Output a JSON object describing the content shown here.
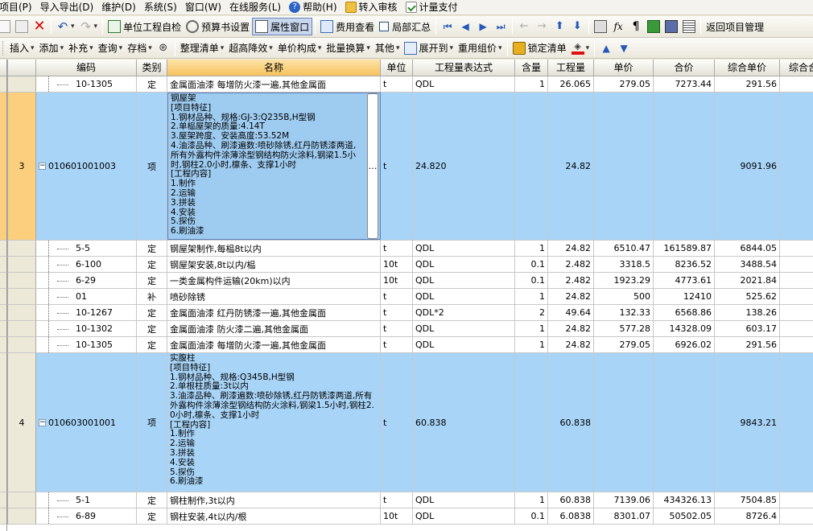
{
  "menu": [
    "项目(P)",
    "导入导出(D)",
    "维护(D)",
    "系统(S)",
    "窗口(W)",
    "在线服务(L)",
    "帮助(H)",
    "转入审核",
    "计量支付"
  ],
  "toolbar1": {
    "unit_check": "单位工程自检",
    "budget_settings": "预算书设置",
    "property_window": "属性窗口",
    "fee_view": "费用查看",
    "partial_summary": "局部汇总",
    "back_to_project": "返回项目管理"
  },
  "toolbar2": {
    "insert": "插入",
    "add": "添加",
    "supplement": "补充",
    "query": "查询",
    "save": "存档",
    "organize": "整理清单",
    "super_height": "超高降效",
    "unit_price_comp": "单价构成",
    "batch_convert": "批量换算",
    "other": "其他",
    "expand_to": "展开到",
    "reuse_price": "重用组价",
    "lock_list": "锁定清单"
  },
  "columns": [
    "编码",
    "类别",
    "名称",
    "单位",
    "工程量表达式",
    "含量",
    "工程量",
    "单价",
    "合价",
    "综合单价",
    "综合合价"
  ],
  "rows": [
    {
      "rownum": "",
      "code": "10-1305",
      "type": "定",
      "name": "金属面油漆 每增防火漆一遍,其他金属面",
      "unit": "t",
      "expr": "QDL",
      "content": "1",
      "qty": "26.065",
      "price": "279.05",
      "total": "7273.44",
      "comp_price": "291.56",
      "comp_total": "7"
    },
    {
      "rownum": "3",
      "code": "010601001003",
      "type": "项",
      "name": "钢屋架\n[项目特征]\n1.钢材品种、规格:GJ-3:Q235B,H型钢\n2.单榀屋架的质量:4.14T\n3.屋架跨度、安装高度:53.52M\n4.油漆品种、刷漆遍数:喷砂除锈,红丹防锈漆两道,所有外露构件涂薄涂型钢结构防火涂料,钢梁1.5小时,钢柱2.0小时,檩条、支撑1小时\n[工程内容]\n1.制作\n2.运输\n3.拼装\n4.安装\n5.探伤\n6.刷油漆",
      "unit": "t",
      "expr": "24.820",
      "content": "",
      "qty": "24.82",
      "price": "",
      "total": "",
      "comp_price": "9091.96",
      "comp_total": "225"
    },
    {
      "rownum": "",
      "code": "5-5",
      "type": "定",
      "name": "钢屋架制作,每榀8t以内",
      "unit": "t",
      "expr": "QDL",
      "content": "1",
      "qty": "24.82",
      "price": "6510.47",
      "total": "161589.87",
      "comp_price": "6844.05",
      "comp_total": "169"
    },
    {
      "rownum": "",
      "code": "6-100",
      "type": "定",
      "name": "钢屋架安装,8t以内/榀",
      "unit": "10t",
      "expr": "QDL",
      "content": "0.1",
      "qty": "2.482",
      "price": "3318.5",
      "total": "8236.52",
      "comp_price": "3488.54",
      "comp_total": "8"
    },
    {
      "rownum": "",
      "code": "6-29",
      "type": "定",
      "name": "一类金属构件运输(20km)以内",
      "unit": "10t",
      "expr": "QDL",
      "content": "0.1",
      "qty": "2.482",
      "price": "1923.29",
      "total": "4773.61",
      "comp_price": "2021.84",
      "comp_total": "5"
    },
    {
      "rownum": "",
      "code": "01",
      "type": "补",
      "name": "喷砂除锈",
      "unit": "t",
      "expr": "QDL",
      "content": "1",
      "qty": "24.82",
      "price": "500",
      "total": "12410",
      "comp_price": "525.62",
      "comp_total": "13"
    },
    {
      "rownum": "",
      "code": "10-1267",
      "type": "定",
      "name": "金属面油漆 红丹防锈漆一遍,其他金属面",
      "unit": "t",
      "expr": "QDL*2",
      "content": "2",
      "qty": "49.64",
      "price": "132.33",
      "total": "6568.86",
      "comp_price": "138.26",
      "comp_total": "6"
    },
    {
      "rownum": "",
      "code": "10-1302",
      "type": "定",
      "name": "金属面油漆 防火漆二遍,其他金属面",
      "unit": "t",
      "expr": "QDL",
      "content": "1",
      "qty": "24.82",
      "price": "577.28",
      "total": "14328.09",
      "comp_price": "603.17",
      "comp_total": "14"
    },
    {
      "rownum": "",
      "code": "10-1305",
      "type": "定",
      "name": "金属面油漆 每增防火漆一遍,其他金属面",
      "unit": "t",
      "expr": "QDL",
      "content": "1",
      "qty": "24.82",
      "price": "279.05",
      "total": "6926.02",
      "comp_price": "291.56",
      "comp_total": "7"
    },
    {
      "rownum": "4",
      "code": "010603001001",
      "type": "项",
      "name": "实腹柱\n[项目特征]\n1.钢材品种、规格:Q345B,H型钢\n2.单根柱质量:3t以内\n3.油漆品种、刷漆遍数:喷砂除锈,红丹防锈漆两道,所有外露构件涂薄涂型钢结构防火涂料,钢梁1.5小时,钢柱2.0小时,檩条、支撑1小时\n[工程内容]\n1.制作\n2.运输\n3.拼装\n4.安装\n5.探伤\n6.刷油漆",
      "unit": "t",
      "expr": "60.838",
      "content": "",
      "qty": "60.838",
      "price": "",
      "total": "",
      "comp_price": "9843.21",
      "comp_total": "598"
    },
    {
      "rownum": "",
      "code": "5-1",
      "type": "定",
      "name": "钢柱制作,3t以内",
      "unit": "t",
      "expr": "QDL",
      "content": "1",
      "qty": "60.838",
      "price": "7139.06",
      "total": "434326.13",
      "comp_price": "7504.85",
      "comp_total": "456"
    },
    {
      "rownum": "",
      "code": "6-89",
      "type": "定",
      "name": "钢柱安装,4t以内/根",
      "unit": "10t",
      "expr": "QDL",
      "content": "0.1",
      "qty": "6.0838",
      "price": "8301.07",
      "total": "50502.05",
      "comp_price": "8726.4",
      "comp_total": "53"
    }
  ]
}
